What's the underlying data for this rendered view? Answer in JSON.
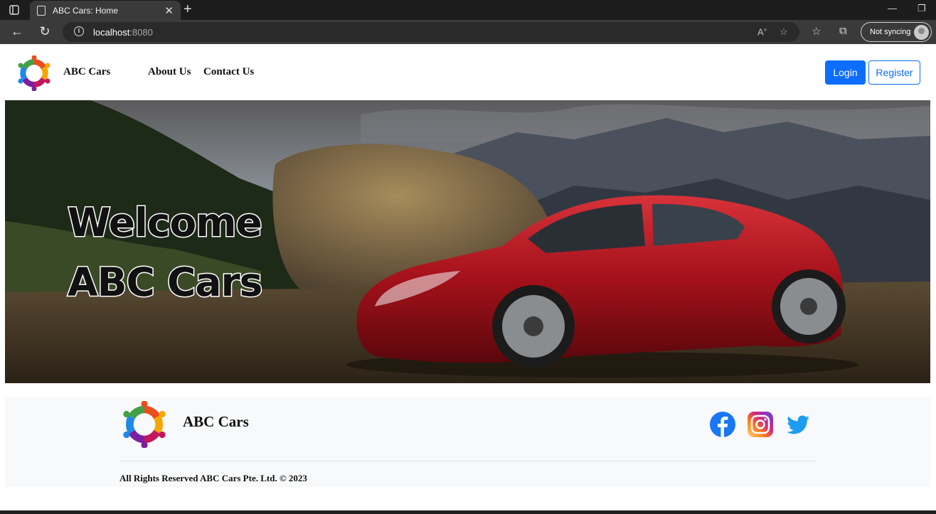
{
  "browser": {
    "tab_title": "ABC Cars: Home",
    "url_host": "localhost",
    "url_port": ":8080",
    "sync_label": "Not syncing"
  },
  "nav": {
    "brand": "ABC Cars",
    "links": [
      "About Us",
      "Contact Us"
    ],
    "login_label": "Login",
    "register_label": "Register"
  },
  "hero": {
    "line1": "Welcome",
    "line2": "ABC Cars"
  },
  "footer": {
    "brand": "ABC Cars",
    "social_icons": [
      "facebook-icon",
      "instagram-icon",
      "twitter-icon"
    ],
    "copyright": "All Rights Reserved ABC Cars Pte. Ltd. © 2023"
  },
  "colors": {
    "primary": "#0d6efd",
    "footer_bg": "#f8f9fa",
    "car_red": "#b3141b"
  }
}
